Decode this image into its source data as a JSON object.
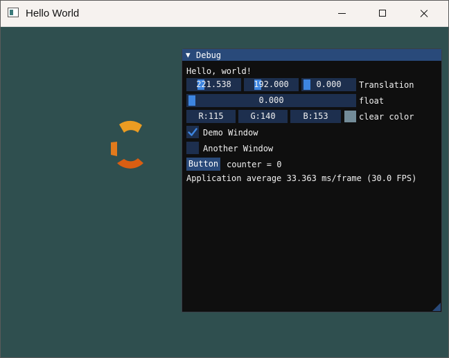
{
  "window": {
    "title": "Hello World"
  },
  "debug": {
    "title": "Debug",
    "hello_text": "Hello, world!",
    "translation": {
      "x": "221.538",
      "y": "192.000",
      "z": "0.000",
      "label": "Translation"
    },
    "float_slider": {
      "value": "0.000",
      "label": "float"
    },
    "clear_color": {
      "r": "R:115",
      "g": "G:140",
      "b": "B:153",
      "label": "clear color",
      "swatch": "#738c99"
    },
    "demo_window": {
      "label": "Demo Window",
      "checked": true
    },
    "another_window": {
      "label": "Another Window",
      "checked": false
    },
    "button": {
      "label": "Button"
    },
    "counter_text": "counter = 0",
    "fps_text": "Application average 33.363 ms/frame (30.0 FPS)"
  },
  "colors": {
    "clear": "#2f4f4f",
    "accent": "#3d85e0",
    "spinner": "#e8901c"
  }
}
